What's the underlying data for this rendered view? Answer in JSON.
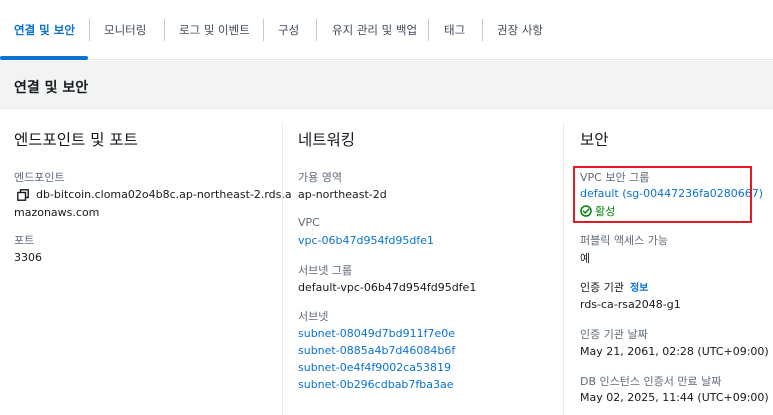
{
  "tabs": [
    {
      "label": "연결 및 보안",
      "active": true
    },
    {
      "label": "모니터링",
      "active": false
    },
    {
      "label": "로그 및 이벤트",
      "active": false
    },
    {
      "label": "구성",
      "active": false
    },
    {
      "label": "유지 관리 및 백업",
      "active": false
    },
    {
      "label": "태그",
      "active": false
    },
    {
      "label": "권장 사항",
      "active": false
    }
  ],
  "panel": {
    "title": "연결 및 보안"
  },
  "endpoint_section": {
    "title": "엔드포인트 및 포트",
    "endpoint_label": "엔드포인트",
    "endpoint_value_line1": "db-bitcoin.cloma02o4b8c.ap-northeast-2.rds.a",
    "endpoint_value_line2": "mazonaws.com",
    "port_label": "포트",
    "port_value": "3306"
  },
  "networking_section": {
    "title": "네트워킹",
    "az_label": "가용 영역",
    "az_value": "ap-northeast-2d",
    "vpc_label": "VPC",
    "vpc_value": "vpc-06b47d954fd95dfe1",
    "subnet_group_label": "서브넷 그룹",
    "subnet_group_value": "default-vpc-06b47d954fd95dfe1",
    "subnets_label": "서브넷",
    "subnets": [
      "subnet-08049d7bd911f7e0e",
      "subnet-0885a4b7d46084b6f",
      "subnet-0e4f4f9002ca53819",
      "subnet-0b296cdbab7fba3ae"
    ]
  },
  "security_section": {
    "title": "보안",
    "vpc_sg_label": "VPC 보안 그룹",
    "vpc_sg_value": "default (sg-00447236fa0280667)",
    "vpc_sg_status": "활성",
    "public_access_label": "퍼블릭 액세스 가능",
    "public_access_value": "예",
    "ca_label": "인증 기관",
    "ca_info": "정보",
    "ca_value": "rds-ca-rsa2048-g1",
    "ca_date_label": "인증 기관 날짜",
    "ca_date_value": "May 21, 2061, 02:28 (UTC+09:00)",
    "cert_expiry_label": "DB 인스턴스 인증서 만료 날짜",
    "cert_expiry_value": "May 02, 2025, 11:44 (UTC+09:00)"
  },
  "colors": {
    "link": "#0972d3",
    "success": "#037f0c",
    "highlight": "#e01b24"
  }
}
